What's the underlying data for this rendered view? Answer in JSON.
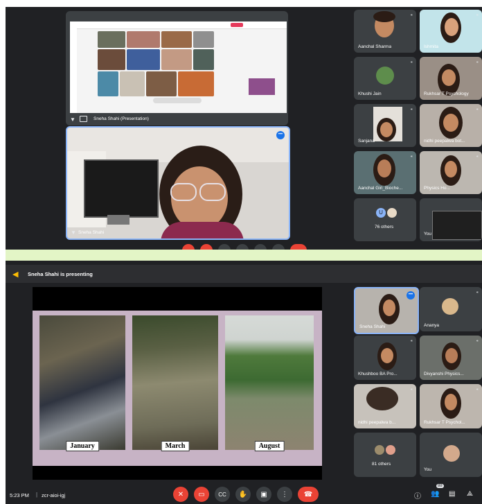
{
  "top_screen": {
    "presentation_label": "Sneha Shahi (Presentation)",
    "speaker_label": "Sneha Shahi",
    "participants": [
      {
        "name": "Aanchal Sharma"
      },
      {
        "name": "Ishmita"
      },
      {
        "name": "Khushi Jain"
      },
      {
        "name": "Rukhsar T Psychology"
      },
      {
        "name": "Sanjana"
      },
      {
        "name": "nidhi peepalwa bot..."
      },
      {
        "name": "Aanchal Giri_Bioche..."
      },
      {
        "name": "Physics Ho..."
      }
    ],
    "others_label": "76 others",
    "others_initial": "U",
    "you_label": "You"
  },
  "bottom_screen": {
    "presenting_banner": "Sneha Shahi is presenting",
    "slide_captions": [
      "January",
      "March",
      "August"
    ],
    "participants": [
      {
        "name": "Sneha Shahi"
      },
      {
        "name": "Ananya"
      },
      {
        "name": "Khushboo BA Pro..."
      },
      {
        "name": "Divyanshi Physics..."
      },
      {
        "name": "nidhi peepalwa b..."
      },
      {
        "name": "Rukhsar T Psychol..."
      }
    ],
    "others_label": "81 others",
    "you_label": "You",
    "time": "5:23 PM",
    "meeting_code": "zcr-aioi-igj",
    "participant_count": "88"
  },
  "colors": {
    "meet_dark": "#202124",
    "tile_grey": "#3c4043",
    "end_call_red": "#ea4335",
    "divider_green": "#e3f5c6",
    "active_blue": "#8ab4f8"
  }
}
